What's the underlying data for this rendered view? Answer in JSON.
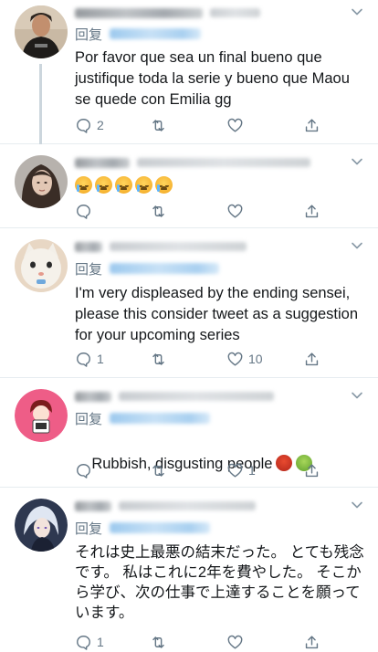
{
  "reply_prefix": "回复",
  "tweets": [
    {
      "body": "Por favor que sea un final bueno que justifique toda la serie y bueno que Maou se quede con Emilia gg",
      "replies": "2",
      "retweets": "",
      "likes": ""
    },
    {
      "emoji": [
        "loudly-crying-face",
        "loudly-crying-face",
        "loudly-crying-face",
        "loudly-crying-face",
        "loudly-crying-face"
      ],
      "replies": "",
      "retweets": "",
      "likes": ""
    },
    {
      "body": "I'm very displeased by the ending sensei, please this consider tweet as a suggestion for your upcoming series",
      "replies": "1",
      "retweets": "",
      "likes": "10"
    },
    {
      "body": "Rubbish, disgusting people",
      "body_emoji": [
        "face-with-symbols-on-mouth",
        "nauseated-face"
      ],
      "replies": "",
      "retweets": "",
      "likes": "1"
    },
    {
      "body": "それは史上最悪の結末だった。 とても残念です。 私はこれに2年を費やした。 そこから学び、次の仕事で上達することを願っています。",
      "replies": "1",
      "retweets": "",
      "likes": ""
    }
  ],
  "colors": {
    "text": "#14171a",
    "muted": "#657786",
    "divider": "#e6ecf0",
    "thread_line": "#ccd6dd"
  },
  "icons": [
    "reply-icon",
    "retweet-icon",
    "like-icon",
    "share-icon",
    "chevron-down-icon"
  ]
}
